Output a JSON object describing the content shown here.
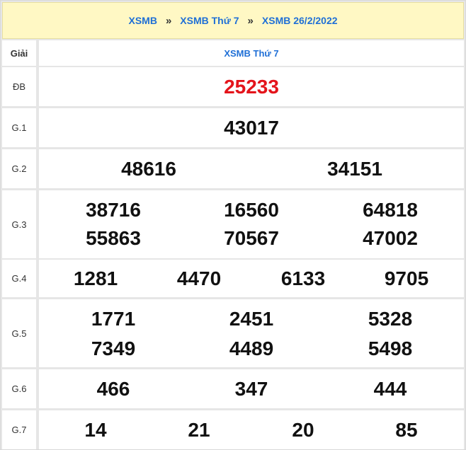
{
  "breadcrumb": {
    "item1": "XSMB",
    "sep1": "»",
    "item2": "XSMB Thứ 7",
    "sep2": "»",
    "item3": "XSMB 26/2/2022"
  },
  "table": {
    "header_label": "Giải",
    "header_title": "XSMB Thứ 7",
    "accent_color": "#1f6fd6",
    "special_color": "#e4141b",
    "header_bg": "#fff8c4"
  },
  "prizes": {
    "db": {
      "label": "ĐB",
      "numbers": [
        "25233"
      ]
    },
    "g1": {
      "label": "G.1",
      "numbers": [
        "43017"
      ]
    },
    "g2": {
      "label": "G.2",
      "numbers": [
        "48616",
        "34151"
      ]
    },
    "g3": {
      "label": "G.3",
      "numbers": [
        "38716",
        "16560",
        "64818",
        "55863",
        "70567",
        "47002"
      ]
    },
    "g4": {
      "label": "G.4",
      "numbers": [
        "1281",
        "4470",
        "6133",
        "9705"
      ]
    },
    "g5": {
      "label": "G.5",
      "numbers": [
        "1771",
        "2451",
        "5328",
        "7349",
        "4489",
        "5498"
      ]
    },
    "g6": {
      "label": "G.6",
      "numbers": [
        "466",
        "347",
        "444"
      ]
    },
    "g7": {
      "label": "G.7",
      "numbers": [
        "14",
        "21",
        "20",
        "85"
      ]
    }
  }
}
